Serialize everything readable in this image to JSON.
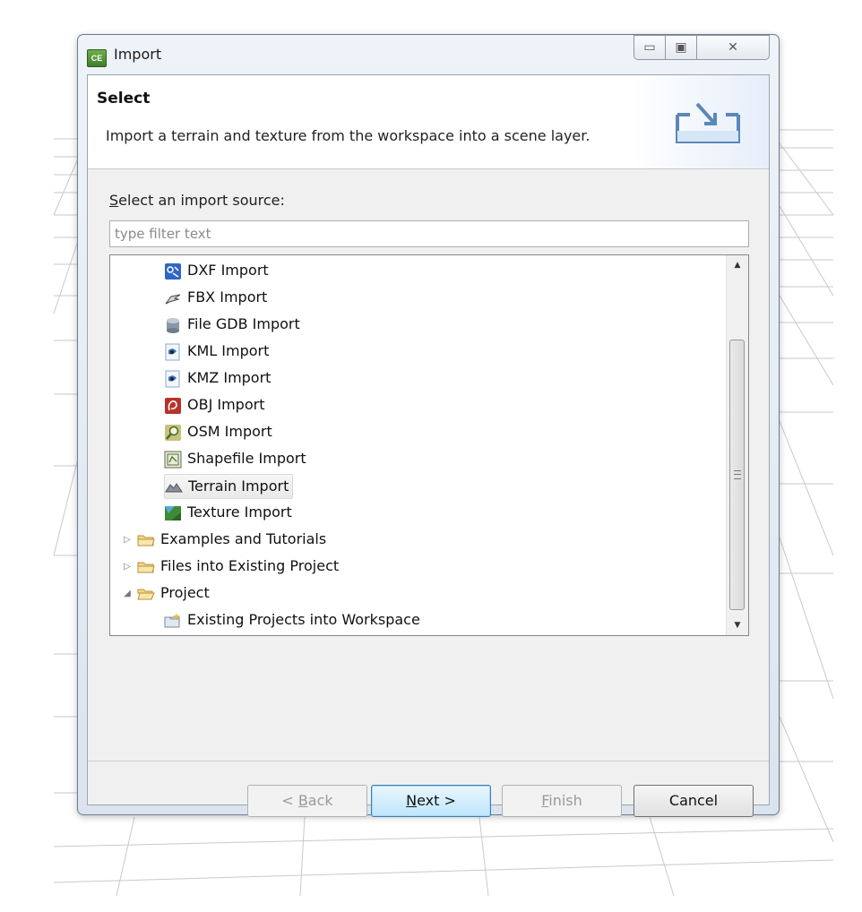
{
  "window": {
    "title": "Import",
    "app_icon_text": "CE",
    "controls": {
      "minimize": "▭",
      "maximize": "▣",
      "close": "✕"
    }
  },
  "header": {
    "title": "Select",
    "description": "Import a terrain and texture from the workspace into a scene layer."
  },
  "source": {
    "label_accel": "S",
    "label_rest": "elect an import source:",
    "filter_placeholder": "type filter text"
  },
  "tree": {
    "items": [
      {
        "label": "DXF Import",
        "icon": "dxf-icon",
        "level": 1
      },
      {
        "label": "FBX Import",
        "icon": "fbx-icon",
        "level": 1
      },
      {
        "label": "File GDB Import",
        "icon": "database-icon",
        "level": 1
      },
      {
        "label": "KML Import",
        "icon": "kml-icon",
        "level": 1
      },
      {
        "label": "KMZ Import",
        "icon": "kmz-icon",
        "level": 1
      },
      {
        "label": "OBJ Import",
        "icon": "obj-icon",
        "level": 1
      },
      {
        "label": "OSM Import",
        "icon": "osm-icon",
        "level": 1
      },
      {
        "label": "Shapefile Import",
        "icon": "shapefile-icon",
        "level": 1
      },
      {
        "label": "Terrain Import",
        "icon": "terrain-icon",
        "level": 1,
        "selected": true
      },
      {
        "label": "Texture Import",
        "icon": "texture-icon",
        "level": 1
      },
      {
        "label": "Examples and Tutorials",
        "icon": "folder-icon",
        "level": 0,
        "expander": "▷"
      },
      {
        "label": "Files into Existing Project",
        "icon": "folder-icon",
        "level": 0,
        "expander": "▷"
      },
      {
        "label": "Project",
        "icon": "folder-open-icon",
        "level": 0,
        "expander": "◢"
      },
      {
        "label": "Existing Projects into Workspace",
        "icon": "project-icon",
        "level": 1
      }
    ]
  },
  "buttons": {
    "back_prefix": "< ",
    "back_accel": "B",
    "back_rest": "ack",
    "next_accel": "N",
    "next_rest": "ext >",
    "finish_accel": "F",
    "finish_rest": "inish",
    "cancel": "Cancel"
  }
}
